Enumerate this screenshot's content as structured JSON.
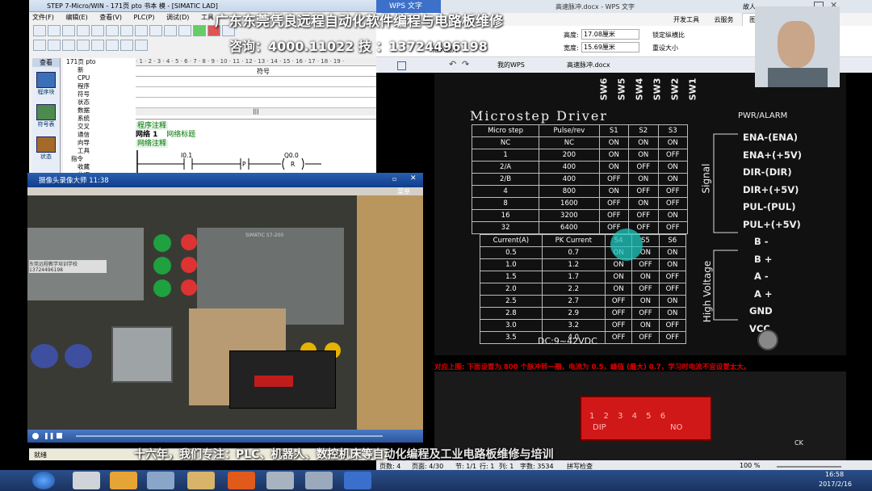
{
  "step7": {
    "title": "STEP 7-Micro/WIN - 171页 pto 书本 模 - [SIMATIC LAD]",
    "menu": [
      "文件(F)",
      "编辑(E)",
      "查看(V)",
      "PLC(P)",
      "调试(D)",
      "工具"
    ],
    "nav_header": "查看",
    "nav_items": [
      "程序块",
      "符号表",
      "状态"
    ],
    "tree_root": "171页 pto",
    "tree_items": [
      "新",
      "CPU",
      "程序",
      "符号",
      "状态",
      "数据",
      "系统",
      "交叉",
      "通信",
      "向导",
      "工具",
      "指令",
      "收藏",
      "位逻"
    ],
    "symbol_header": "符号",
    "program_comment": "程序注释",
    "network_label": "网络 1",
    "network_title": "网络标题",
    "network_comment": "网络注释",
    "contact_addr": "I0.1",
    "contact_type": "P",
    "coil_addr": "Q0.0",
    "coil_type": "R",
    "coil_count": "1",
    "ruler": "· 1 · 2 · 3 · 4 · 5 · 6 · 7 · 8 · 9 · 10 · 11 · 12 · 13 · 14 · 15 · 16 · 17 · 18 · 19 ·",
    "status": "就绪",
    "status_network": "网络 2",
    "status_row": "行 1",
    "col_marker": "|||"
  },
  "wps": {
    "app_title": "WPS 文字",
    "doc_title": "高速脉冲.docx - WPS 文字",
    "ribbon_tabs": [
      "开发工具",
      "云服务",
      "图片工具"
    ],
    "height_label": "高度:",
    "height_value": "17.08厘米",
    "width_label": "宽度:",
    "width_value": "15.69厘米",
    "lock_label": "锁定纵横比",
    "reset_label": "重设大小",
    "insert_label": "插入图片",
    "user_name": "故人",
    "doc_tabs": [
      "我的WPS",
      "高速脉冲.docx"
    ],
    "status_items": [
      "页数: 4",
      "页面: 4/30",
      "节: 1/1",
      "行: 1",
      "列: 1",
      "字数: 3534",
      "拼写检查"
    ],
    "zoom": "100 %",
    "caption": "对应上图: 下面设置为 800 个脉冲转一圈，电流为 0.5，峰值 (最大) 0.7，学习时电流不宜设置太大。",
    "unit_marker": "CK"
  },
  "driver_panel": {
    "title": "Microstep Driver",
    "sw_labels": [
      "SW6",
      "SW5",
      "SW4",
      "SW3",
      "SW2",
      "SW1"
    ],
    "pwr_alarm": "PWR/ALARM",
    "step_headers": [
      "Micro step",
      "Pulse/rev",
      "S1",
      "S2",
      "S3"
    ],
    "step_rows": [
      [
        "NC",
        "NC",
        "ON",
        "ON",
        "ON"
      ],
      [
        "1",
        "200",
        "ON",
        "ON",
        "OFF"
      ],
      [
        "2/A",
        "400",
        "ON",
        "OFF",
        "ON"
      ],
      [
        "2/B",
        "400",
        "OFF",
        "ON",
        "ON"
      ],
      [
        "4",
        "800",
        "ON",
        "OFF",
        "OFF"
      ],
      [
        "8",
        "1600",
        "OFF",
        "ON",
        "OFF"
      ],
      [
        "16",
        "3200",
        "OFF",
        "OFF",
        "ON"
      ],
      [
        "32",
        "6400",
        "OFF",
        "OFF",
        "OFF"
      ]
    ],
    "current_headers": [
      "Current(A)",
      "PK Current",
      "S4",
      "S5",
      "S6"
    ],
    "current_rows": [
      [
        "0.5",
        "0.7",
        "ON",
        "ON",
        "ON"
      ],
      [
        "1.0",
        "1.2",
        "ON",
        "OFF",
        "ON"
      ],
      [
        "1.5",
        "1.7",
        "ON",
        "ON",
        "OFF"
      ],
      [
        "2.0",
        "2.2",
        "ON",
        "OFF",
        "OFF"
      ],
      [
        "2.5",
        "2.7",
        "OFF",
        "ON",
        "ON"
      ],
      [
        "2.8",
        "2.9",
        "OFF",
        "OFF",
        "ON"
      ],
      [
        "3.0",
        "3.2",
        "OFF",
        "ON",
        "OFF"
      ],
      [
        "3.5",
        "4.0",
        "OFF",
        "OFF",
        "OFF"
      ]
    ],
    "signal_label": "Signal",
    "hv_label": "High Voltage",
    "terminals": [
      "ENA-(ENA)",
      "ENA+(+5V)",
      "DIR-(DIR)",
      "DIR+(+5V)",
      "PUL-(PUL)",
      "PUL+(+5V)",
      "B -",
      "B +",
      "A -",
      "A +",
      "GND",
      "VCC"
    ],
    "voltage": "DC:9~42VDC"
  },
  "dip_photo": {
    "numbers": "1 2 3 4 5 6",
    "label_left": "DIP",
    "label_right": "NO"
  },
  "camera": {
    "title": "摄像头录像大师 11:38",
    "menu": "菜单",
    "sticker": "东莞远程教学培训学校 13724496198",
    "plc_label": "SIMATIC S7-200"
  },
  "watermark": {
    "line1": "广东东莞凭良远程自动化软件编程与电路板维修",
    "line2": "咨询：4000.11022    技    ：13724496198",
    "bottom": "十六年，我们专注：PLC、机器人、数控机床等自动化编程及工业电路板维修与培训"
  },
  "clock": {
    "time": "16:58",
    "date": "2017/2/16"
  },
  "colors": {
    "plc_bg": "#ffffff",
    "panel_bg": "#0d0d0d",
    "highlight": "#20c8c0",
    "taskbar": "#1d3a6e",
    "caption_red": "#e00000"
  }
}
